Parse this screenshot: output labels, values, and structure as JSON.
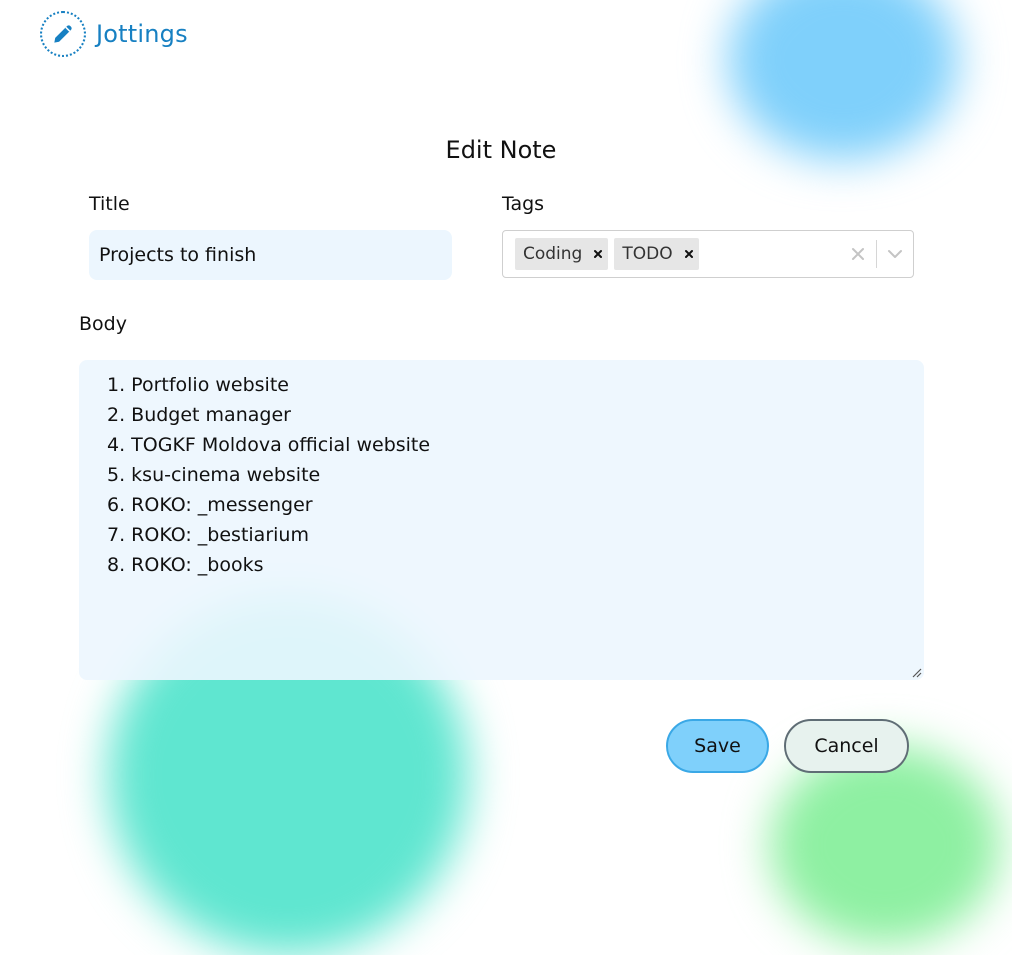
{
  "app": {
    "name": "Jottings",
    "logo_icon": "pencil-icon",
    "brand_color": "#1780c2"
  },
  "page": {
    "title": "Edit Note"
  },
  "form": {
    "title_label": "Title",
    "title_value": "Projects to finish",
    "tags_label": "Tags",
    "tags": [
      {
        "label": "Coding"
      },
      {
        "label": "TODO"
      }
    ],
    "body_label": "Body",
    "body_lines": [
      "1. Portfolio website",
      "2. Budget manager",
      "4. TOGKF Moldova official website",
      "5. ksu-cinema website",
      "6. ROKO: _messenger",
      "7. ROKO: _bestiarium",
      "8. ROKO: _books"
    ]
  },
  "actions": {
    "save_label": "Save",
    "cancel_label": "Cancel"
  },
  "colors": {
    "input_bg": "#ecf6fe",
    "save_bg": "#7fd0fb",
    "blob_blue": "#7fd0fb",
    "blob_teal": "#5fe6d0",
    "blob_green": "#8ef0a2"
  }
}
